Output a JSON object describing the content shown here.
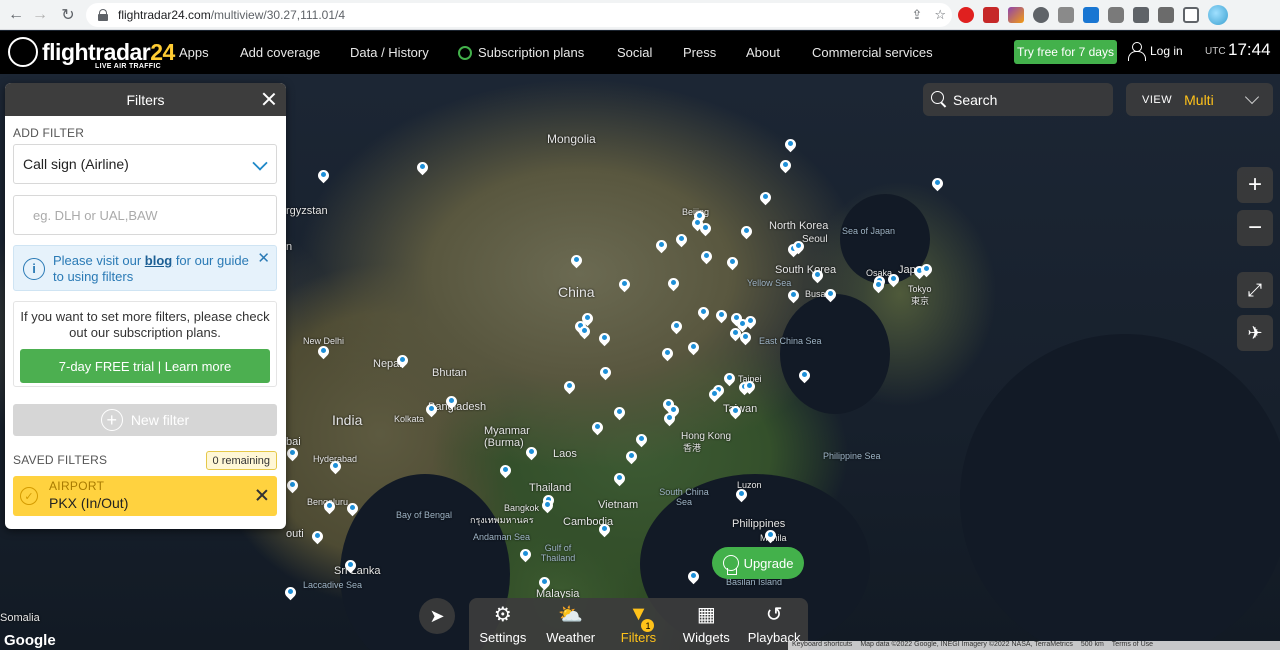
{
  "browser": {
    "url_host": "flightradar24.com",
    "url_path": "/multiview/30.27,111.01/4"
  },
  "header": {
    "logo_text": "flightradar",
    "logo_num": "24",
    "logo_sub": "LIVE AIR TRAFFIC",
    "nav": [
      "Apps",
      "Add coverage",
      "Data / History",
      "Subscription plans",
      "Social",
      "Press",
      "About",
      "Commercial services"
    ],
    "trial_button": "Try free for 7 days",
    "login": "Log in",
    "utc_label": "UTC",
    "utc_time": "17:44"
  },
  "filters": {
    "title": "Filters",
    "add_filter_label": "ADD FILTER",
    "filter_type": "Call sign (Airline)",
    "input_placeholder": "eg. DLH or UAL,BAW",
    "info_before": "Please visit our ",
    "info_link": "blog",
    "info_after": " for our guide to using filters",
    "upsell_text": "If you want to set more filters, please check out our subscription plans.",
    "trial_button": "7-day FREE trial | Learn more",
    "new_filter": "New filter",
    "saved_label": "SAVED FILTERS",
    "remaining": "0 remaining",
    "saved": {
      "type": "AIRPORT",
      "name": "PKX (In/Out)"
    }
  },
  "controls": {
    "search_label": "Search",
    "view_label": "VIEW",
    "view_value": "Multi",
    "upgrade": "Upgrade"
  },
  "toolbar": {
    "items": [
      "Settings",
      "Weather",
      "Filters",
      "Widgets",
      "Playback"
    ],
    "filter_count": "1"
  },
  "map": {
    "labels": {
      "mongolia": "Mongolia",
      "china": "China",
      "india": "India",
      "north_korea": "North Korea",
      "seoul": "Seoul",
      "south_korea": "South Korea",
      "sea_of_japan": "Sea of Japan",
      "yellow_sea": "Yellow Sea",
      "east_china_sea": "East China Sea",
      "tokyo": "Tokyo",
      "tokyo_local": "東京",
      "japan": "Japan",
      "osaka": "Osaka",
      "busan": "Busan",
      "beijing": "Beijing",
      "taipei": "Taipei",
      "taiwan": "Taiwan",
      "hong_kong": "Hong Kong",
      "hong_kong_local": "香港",
      "philippine_sea": "Philippine Sea",
      "luzon": "Luzon",
      "philippines": "Philippines",
      "manila": "Manila",
      "south_china_sea": "South China Sea",
      "vietnam": "Vietnam",
      "laos": "Laos",
      "thailand": "Thailand",
      "bangkok": "Bangkok",
      "bangkok_local": "กรุงเทพมหานคร",
      "cambodia": "Cambodia",
      "myanmar": "Myanmar (Burma)",
      "bangladesh": "Bangladesh",
      "bhutan": "Bhutan",
      "nepal": "Nepal",
      "new_delhi": "New Delhi",
      "kolkata": "Kolkata",
      "hyderabad": "Hyderabad",
      "bengaluru": "Bengaluru",
      "sri_lanka": "Sri Lanka",
      "bay_of_bengal": "Bay of Bengal",
      "andaman_sea": "Andaman Sea",
      "gulf_of_thailand": "Gulf of Thailand",
      "laccadive_sea": "Laccadive Sea",
      "malaysia": "Malaysia",
      "kyrgyzstan": "rgyzstan",
      "somalia": "Somalia",
      "basilan": "Basilan Island",
      "left_fragment_ai": "bai",
      "left_fragment_outi": "outi",
      "left_fragment_n": "n"
    },
    "google": "Google",
    "attribution": [
      "Keyboard shortcuts",
      "Map data ©2022 Google, INEGI Imagery ©2022 NASA, TerraMetrics",
      "500 km",
      "Terms of Use"
    ]
  },
  "colors": {
    "accent_green": "#43b14b",
    "accent_yellow": "#ffc21a",
    "pin_blue": "#1d8fd8"
  }
}
